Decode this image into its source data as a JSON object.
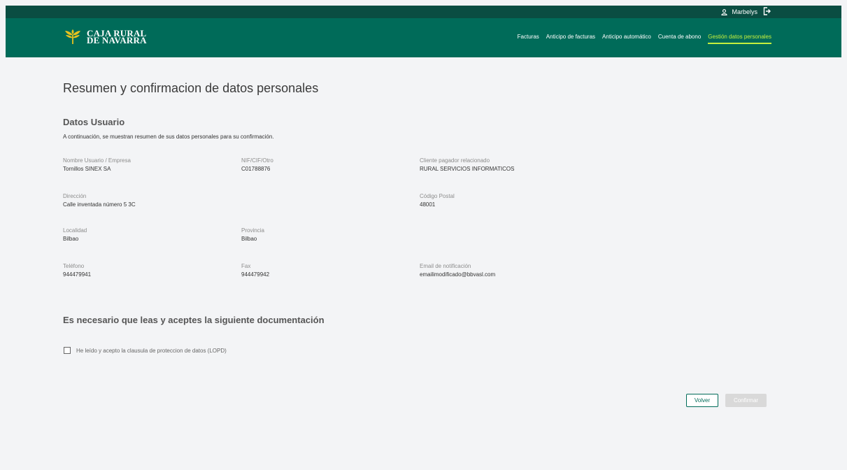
{
  "header": {
    "user_name": "Marbelys",
    "user_icon": "user-icon",
    "logout_icon": "logout-icon",
    "logo": {
      "line1": "CAJA RURAL",
      "line2": "DE NAVARRA"
    }
  },
  "nav": {
    "items": [
      {
        "label": "Facturas"
      },
      {
        "label": "Anticipo de facturas"
      },
      {
        "label": "Anticipo automático"
      },
      {
        "label": "Cuenta de abono"
      },
      {
        "label": "Gestión datos personales",
        "active": true
      }
    ]
  },
  "main": {
    "title": "Resumen y confirmacion de datos personales",
    "section_title": "Datos Usuario",
    "intro": "A continuación, se muestran resumen de sus datos personales para su confirmación.",
    "fields": {
      "nombre": {
        "label": "Nombre Usuario / Empresa",
        "value": "Tornillos SINEX SA"
      },
      "nif": {
        "label": "NIF/CIF/Otro",
        "value": "C01788876"
      },
      "cliente": {
        "label": "Cliente pagador relacionado",
        "value": "RURAL SERVICIOS INFORMATICOS"
      },
      "direccion": {
        "label": "Dirección",
        "value": "Calle inventada número 5 3C"
      },
      "cp": {
        "label": "Código Postal",
        "value": "48001"
      },
      "localidad": {
        "label": "Localidad",
        "value": "Bilbao"
      },
      "provincia": {
        "label": "Provincia",
        "value": "Bilbao"
      },
      "telefono": {
        "label": "Teléfono",
        "value": "944479941"
      },
      "fax": {
        "label": "Fax",
        "value": "944479942"
      },
      "email": {
        "label": "Email de notificación",
        "value": "emailimodificado@bbvasl.com"
      }
    },
    "doc_title": "Es necesario que leas y aceptes la siguiente documentación",
    "lopd_label": "He leído y acepto la clausula de proteccion de datos (LOPD)",
    "lopd_checked": false
  },
  "actions": {
    "back_label": "Volver",
    "confirm_label": "Confirmar"
  },
  "colors": {
    "topbar": "#0a4d42",
    "navbar": "#006b59",
    "active_nav": "#c4ef3d",
    "logo_gold": "#e8c21e"
  }
}
